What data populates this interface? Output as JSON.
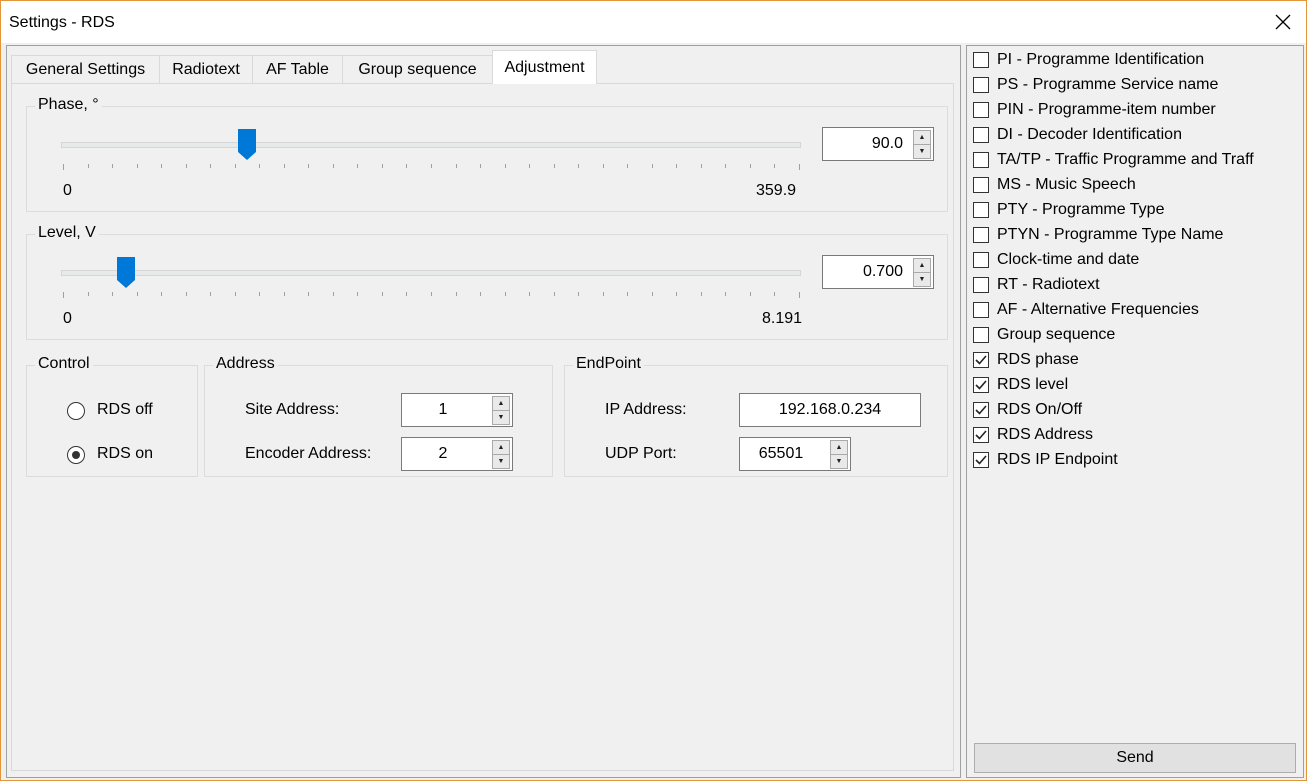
{
  "window": {
    "title": "Settings - RDS",
    "close_icon": "close-icon"
  },
  "tabs": [
    {
      "label": "General Settings",
      "active": false
    },
    {
      "label": "Radiotext",
      "active": false
    },
    {
      "label": "AF Table",
      "active": false
    },
    {
      "label": "Group sequence",
      "active": false
    },
    {
      "label": "Adjustment",
      "active": true
    }
  ],
  "phase": {
    "label": "Phase, °",
    "value": "90.0",
    "min_label": "0",
    "max_label": "359.9",
    "min": 0,
    "max": 359.9,
    "slider_value": 90.0
  },
  "level": {
    "label": "Level, V",
    "value": "0.700",
    "min_label": "0",
    "max_label": "8.191",
    "min": 0,
    "max": 8.191,
    "slider_value": 0.7
  },
  "control": {
    "label": "Control",
    "off_label": "RDS off",
    "on_label": "RDS on",
    "selected": "on"
  },
  "address": {
    "label": "Address",
    "site_label": "Site Address:",
    "site_value": "1",
    "encoder_label": "Encoder Address:",
    "encoder_value": "2"
  },
  "endpoint": {
    "label": "EndPoint",
    "ip_label": "IP Address:",
    "ip_value": "192.168.0.234",
    "port_label": "UDP Port:",
    "port_value": "65501"
  },
  "checklist": [
    {
      "label": "PI - Programme Identification",
      "checked": false
    },
    {
      "label": "PS - Programme Service name",
      "checked": false
    },
    {
      "label": "PIN - Programme-item number",
      "checked": false
    },
    {
      "label": "DI - Decoder Identification",
      "checked": false
    },
    {
      "label": "TA/TP - Traffic Programme and Traff",
      "checked": false
    },
    {
      "label": "MS - Music Speech",
      "checked": false
    },
    {
      "label": "PTY - Programme Type",
      "checked": false
    },
    {
      "label": "PTYN - Programme Type Name",
      "checked": false
    },
    {
      "label": "Clock-time and date",
      "checked": false
    },
    {
      "label": "RT - Radiotext",
      "checked": false
    },
    {
      "label": "AF - Alternative Frequencies",
      "checked": false
    },
    {
      "label": "Group sequence",
      "checked": false
    },
    {
      "label": "RDS phase",
      "checked": true
    },
    {
      "label": "RDS level",
      "checked": true
    },
    {
      "label": "RDS On/Off",
      "checked": true
    },
    {
      "label": "RDS Address",
      "checked": true
    },
    {
      "label": "RDS IP Endpoint",
      "checked": true
    }
  ],
  "send_label": "Send",
  "colors": {
    "window_border": "#e3953a",
    "slider_thumb": "#0078d7"
  }
}
